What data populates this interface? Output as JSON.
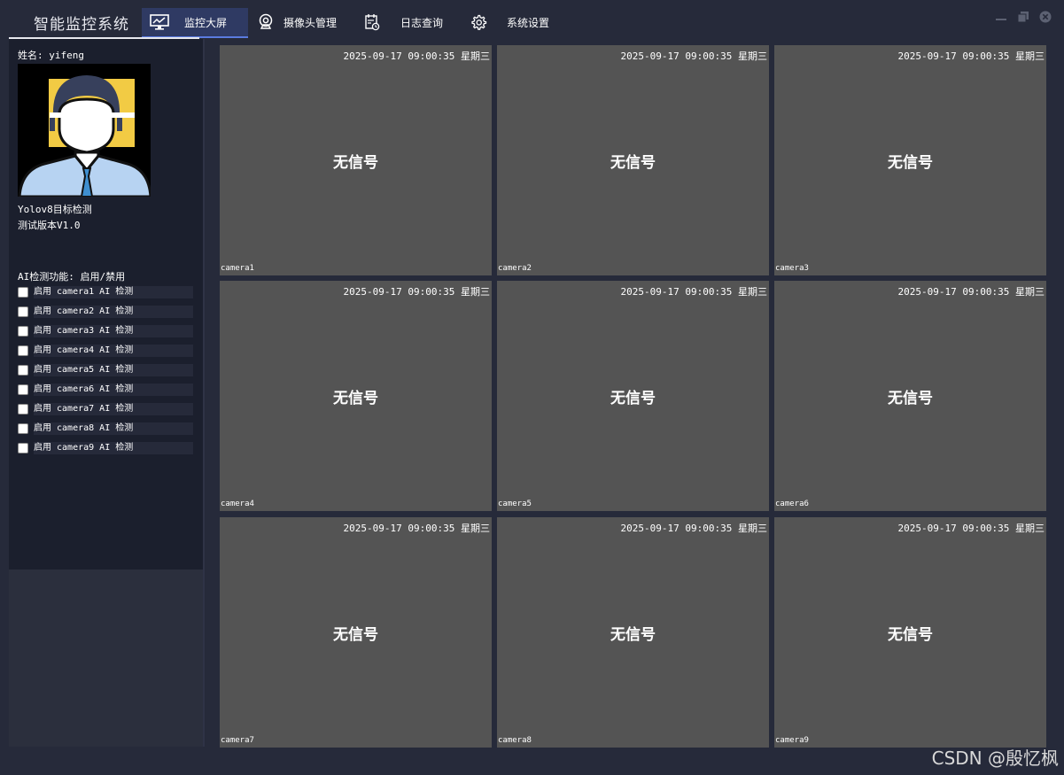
{
  "app": {
    "title": "智能监控系统"
  },
  "tabs": [
    {
      "label": "监控大屏",
      "icon": "monitor-chart-icon",
      "active": true
    },
    {
      "label": "摄像头管理",
      "icon": "webcam-icon",
      "active": false
    },
    {
      "label": "日志查询",
      "icon": "log-calendar-icon",
      "active": false
    },
    {
      "label": "系统设置",
      "icon": "gear-icon",
      "active": false
    }
  ],
  "window_controls": [
    "minimize-icon",
    "restore-icon",
    "close-icon"
  ],
  "sidebar": {
    "user_name": "姓名: yifeng",
    "avatar_icon": "user-avatar-icon",
    "info_lines": [
      "Yolov8目标检测",
      "测试版本V1.0"
    ],
    "ai_title": "AI检测功能: 启用/禁用",
    "ai_items": [
      {
        "label": "启用 camera1 AI 检测",
        "checked": false
      },
      {
        "label": "启用 camera2 AI 检测",
        "checked": false
      },
      {
        "label": "启用 camera3 AI 检测",
        "checked": false
      },
      {
        "label": "启用 camera4 AI 检测",
        "checked": false
      },
      {
        "label": "启用 camera5 AI 检测",
        "checked": false
      },
      {
        "label": "启用 camera6 AI 检测",
        "checked": false
      },
      {
        "label": "启用 camera7 AI 检测",
        "checked": false
      },
      {
        "label": "启用 camera8 AI 检测",
        "checked": false
      },
      {
        "label": "启用 camera9 AI 检测",
        "checked": false
      }
    ]
  },
  "cameras": [
    {
      "name": "camera1",
      "timestamp": "2025-09-17 09:00:35 星期三",
      "status": "无信号"
    },
    {
      "name": "camera2",
      "timestamp": "2025-09-17 09:00:35 星期三",
      "status": "无信号"
    },
    {
      "name": "camera3",
      "timestamp": "2025-09-17 09:00:35 星期三",
      "status": "无信号"
    },
    {
      "name": "camera4",
      "timestamp": "2025-09-17 09:00:35 星期三",
      "status": "无信号"
    },
    {
      "name": "camera5",
      "timestamp": "2025-09-17 09:00:35 星期三",
      "status": "无信号"
    },
    {
      "name": "camera6",
      "timestamp": "2025-09-17 09:00:35 星期三",
      "status": "无信号"
    },
    {
      "name": "camera7",
      "timestamp": "2025-09-17 09:00:35 星期三",
      "status": "无信号"
    },
    {
      "name": "camera8",
      "timestamp": "2025-09-17 09:00:35 星期三",
      "status": "无信号"
    },
    {
      "name": "camera9",
      "timestamp": "2025-09-17 09:00:35 星期三",
      "status": "无信号"
    }
  ],
  "watermark": "CSDN @殷忆枫",
  "colors": {
    "background": "#262a3a",
    "sidebar": "#1b1f2d",
    "camera_tile": "#545454",
    "active_tab": "#2f3a63",
    "accent": "#5b7be0",
    "avatar_highlight": "#f2cb44"
  }
}
